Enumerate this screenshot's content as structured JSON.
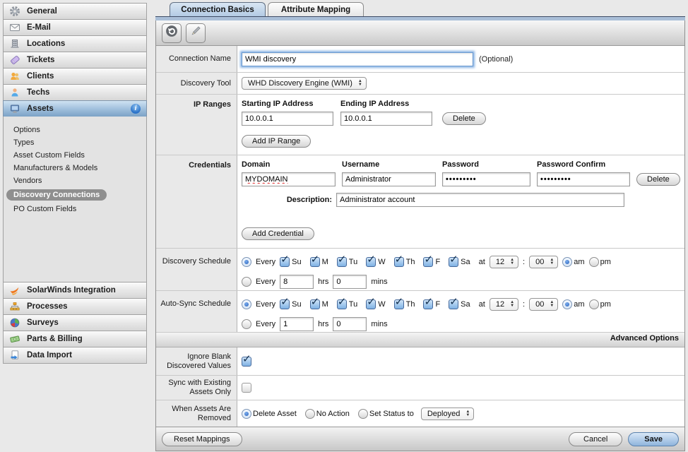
{
  "sidebar": {
    "top_items": [
      {
        "label": "General",
        "icon": "gear-icon"
      },
      {
        "label": "E-Mail",
        "icon": "mail-icon"
      },
      {
        "label": "Locations",
        "icon": "building-icon"
      },
      {
        "label": "Tickets",
        "icon": "tag-icon"
      },
      {
        "label": "Clients",
        "icon": "clients-icon"
      },
      {
        "label": "Techs",
        "icon": "tech-icon"
      },
      {
        "label": "Assets",
        "icon": "monitor-icon",
        "selected": true
      }
    ],
    "asset_subitems": [
      {
        "label": "Options"
      },
      {
        "label": "Types"
      },
      {
        "label": "Asset Custom Fields"
      },
      {
        "label": "Manufacturers & Models"
      },
      {
        "label": "Vendors"
      },
      {
        "label": "Discovery Connections",
        "selected": true
      },
      {
        "label": "PO Custom Fields"
      }
    ],
    "bottom_items": [
      {
        "label": "SolarWinds Integration",
        "icon": "solarwinds-icon"
      },
      {
        "label": "Processes",
        "icon": "org-chart-icon"
      },
      {
        "label": "Surveys",
        "icon": "pie-chart-icon"
      },
      {
        "label": "Parts & Billing",
        "icon": "money-icon"
      },
      {
        "label": "Data Import",
        "icon": "import-icon"
      }
    ]
  },
  "tabs": [
    {
      "label": "Connection Basics",
      "active": true
    },
    {
      "label": "Attribute Mapping",
      "active": false
    }
  ],
  "form": {
    "connection_name": {
      "label": "Connection Name",
      "value": "WMI discovery",
      "optional_note": "(Optional)"
    },
    "discovery_tool": {
      "label": "Discovery Tool",
      "value": "WHD Discovery Engine (WMI)"
    },
    "ip_ranges": {
      "label": "IP Ranges",
      "starting_header": "Starting IP Address",
      "ending_header": "Ending IP Address",
      "starting_value": "10.0.0.1",
      "ending_value": "10.0.0.1",
      "delete_label": "Delete",
      "add_label": "Add IP Range"
    },
    "credentials": {
      "label": "Credentials",
      "domain_header": "Domain",
      "username_header": "Username",
      "password_header": "Password",
      "password_confirm_header": "Password Confirm",
      "domain_value": "MYDOMAIN",
      "username_value": "Administrator",
      "password_value": "•••••••••",
      "password_confirm_value": "•••••••••",
      "delete_label": "Delete",
      "description_label": "Description:",
      "description_value": "Administrator account",
      "add_label": "Add Credential"
    },
    "discovery_schedule": {
      "label": "Discovery Schedule",
      "weekly": {
        "every_label": "Every",
        "days": [
          "Su",
          "M",
          "Tu",
          "W",
          "Th",
          "F",
          "Sa"
        ],
        "at_label": "at",
        "hour": "12",
        "colon": ":",
        "minute": "00",
        "am_label": "am",
        "pm_label": "pm"
      },
      "interval": {
        "every_label": "Every",
        "hours_value": "8",
        "hrs_label": "hrs",
        "minutes_value": "0",
        "mins_label": "mins"
      }
    },
    "auto_sync_schedule": {
      "label": "Auto-Sync Schedule",
      "weekly": {
        "every_label": "Every",
        "days": [
          "Su",
          "M",
          "Tu",
          "W",
          "Th",
          "F",
          "Sa"
        ],
        "at_label": "at",
        "hour": "12",
        "colon": ":",
        "minute": "00",
        "am_label": "am",
        "pm_label": "pm"
      },
      "interval": {
        "every_label": "Every",
        "hours_value": "1",
        "hrs_label": "hrs",
        "minutes_value": "0",
        "mins_label": "mins"
      }
    },
    "advanced": {
      "header": "Advanced Options",
      "ignore_blank": {
        "label": "Ignore Blank Discovered Values",
        "checked": true
      },
      "sync_existing": {
        "label": "Sync with Existing Assets Only",
        "checked": false
      },
      "when_removed": {
        "label": "When Assets Are Removed",
        "options": [
          "Delete Asset",
          "No Action",
          "Set Status to"
        ],
        "selected": "Delete Asset",
        "status_value": "Deployed"
      }
    }
  },
  "footer": {
    "reset_label": "Reset Mappings",
    "cancel_label": "Cancel",
    "save_label": "Save"
  },
  "colors": {
    "tab_active": "#b3cbe4",
    "tab_strip": "#aabfd8",
    "selected_item": "#7ba2c6",
    "selected_pill": "#8f8f8f",
    "save_button": "#8fb4dc",
    "checkbox_blue": "#7fb2e4"
  }
}
